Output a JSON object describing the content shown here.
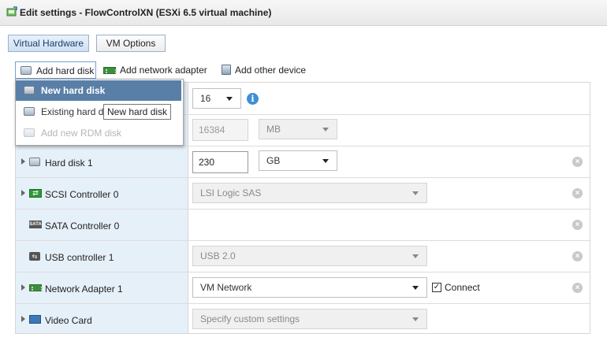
{
  "window": {
    "title": "Edit settings - FlowControlXN (ESXi 6.5 virtual machine)"
  },
  "tabs": [
    {
      "label": "Virtual Hardware",
      "active": true
    },
    {
      "label": "VM Options",
      "active": false
    }
  ],
  "toolbar": {
    "add_hard_disk": "Add hard disk",
    "add_network_adapter": "Add network adapter",
    "add_other_device": "Add other device"
  },
  "dropdown": {
    "items": [
      {
        "label": "New hard disk",
        "state": "highlighted"
      },
      {
        "label": "Existing hard d",
        "state": "normal"
      },
      {
        "label": "Add new RDM disk",
        "state": "disabled"
      }
    ],
    "tooltip": "New hard disk"
  },
  "rows": {
    "memory": {
      "value": "16"
    },
    "memsize": {
      "value": "16384",
      "unit": "MB"
    },
    "hard_disk": {
      "label": "Hard disk 1",
      "value": "230",
      "unit": "GB"
    },
    "scsi": {
      "label": "SCSI Controller 0",
      "value": "LSI Logic SAS"
    },
    "sata": {
      "label": "SATA Controller 0"
    },
    "usb": {
      "label": "USB controller 1",
      "value": "USB 2.0"
    },
    "network": {
      "label": "Network Adapter 1",
      "value": "VM Network",
      "connect_label": "Connect",
      "connected": true
    },
    "video": {
      "label": "Video Card",
      "value": "Specify custom settings"
    }
  },
  "icons": {
    "info": "i",
    "remove": "×",
    "check": "✓",
    "usb": "⇆",
    "sata": "SATA",
    "scsi": "⇄"
  },
  "colors": {
    "accent": "#5a7fa6",
    "left_col": "#e6f0f9",
    "info": "#3f8fd6"
  }
}
